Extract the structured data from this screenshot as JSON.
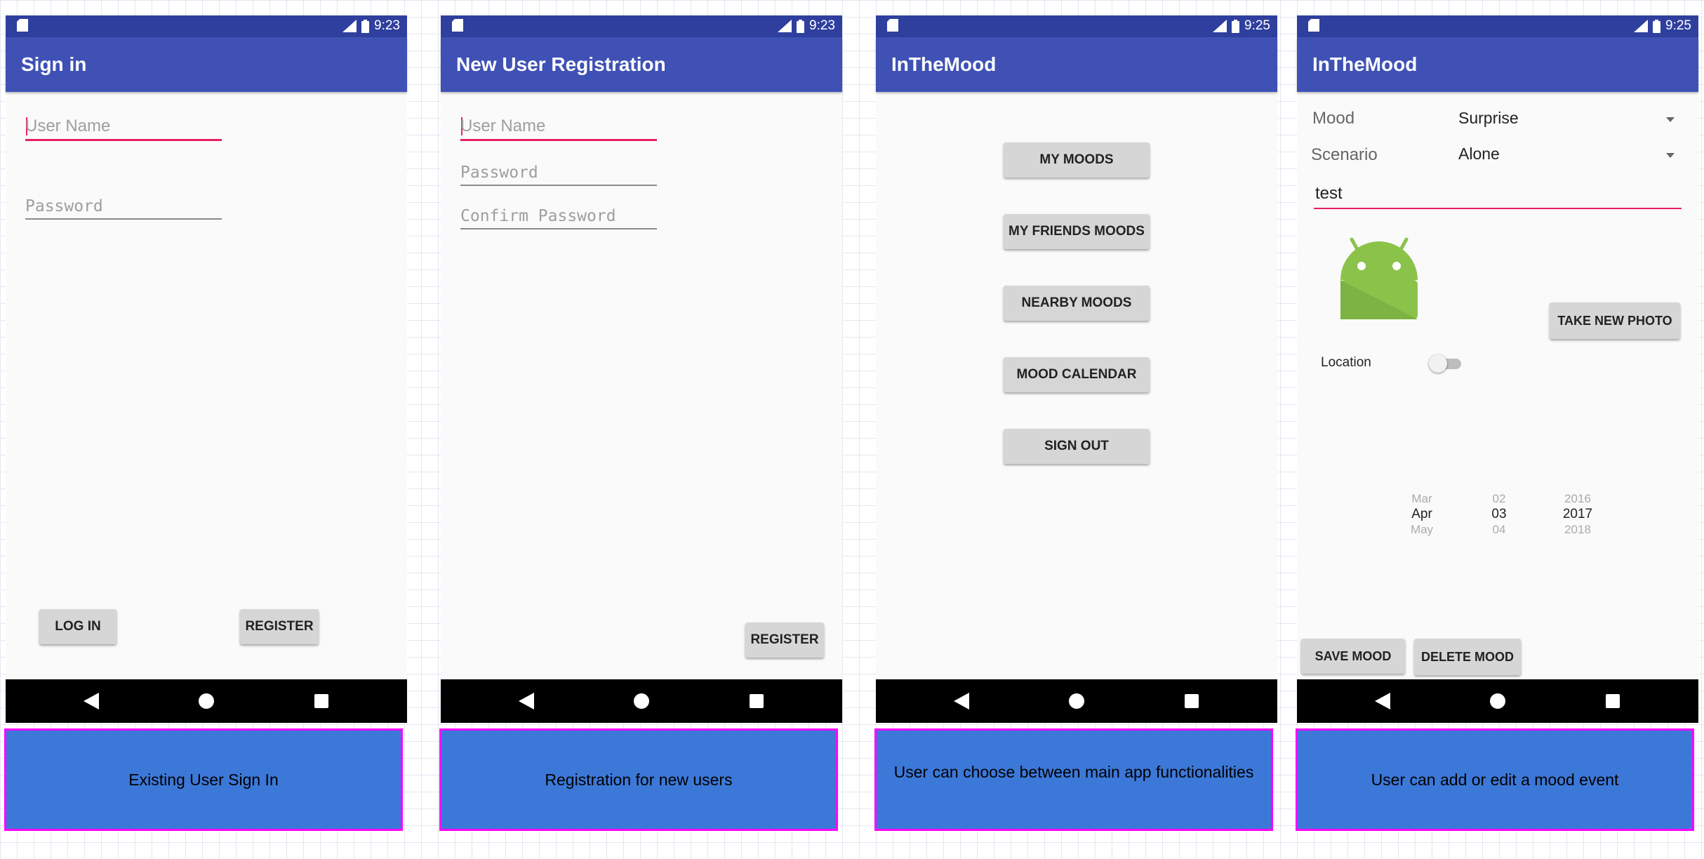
{
  "screens": [
    {
      "time": "9:23",
      "title": "Sign in",
      "fields": {
        "username_placeholder": "User Name",
        "password_placeholder": "Password"
      },
      "buttons": {
        "login": "LOG IN",
        "register": "REGISTER"
      },
      "caption": "Existing User Sign In"
    },
    {
      "time": "9:23",
      "title": "New User Registration",
      "fields": {
        "username_placeholder": "User Name",
        "password_placeholder": "Password",
        "confirm_placeholder": "Confirm Password"
      },
      "buttons": {
        "register": "REGISTER"
      },
      "caption": "Registration for new users"
    },
    {
      "time": "9:25",
      "title": "InTheMood",
      "menu": [
        "MY MOODS",
        "MY FRIENDS MOODS",
        "NEARBY MOODS",
        "MOOD CALENDAR",
        "SIGN OUT"
      ],
      "caption": "User can choose between main app functionalities"
    },
    {
      "time": "9:25",
      "title": "InTheMood",
      "mood_label": "Mood",
      "mood_value": "Surprise",
      "scenario_label": "Scenario",
      "scenario_value": "Alone",
      "text_value": "test",
      "take_photo": "TAKE NEW PHOTO",
      "location_label": "Location",
      "location_on": false,
      "date_picker": {
        "months": [
          "Mar",
          "Apr",
          "May"
        ],
        "days": [
          "02",
          "03",
          "04"
        ],
        "years": [
          "2016",
          "2017",
          "2018"
        ]
      },
      "save": "SAVE MOOD",
      "delete": "DELETE MOOD",
      "caption": "User can add or edit a mood event"
    }
  ],
  "colors": {
    "primary": "#3f51b5",
    "primary_dark": "#2f3f9e",
    "accent": "#e91e63",
    "caption_bg": "#3c78d8",
    "caption_border": "#ff00ff"
  }
}
